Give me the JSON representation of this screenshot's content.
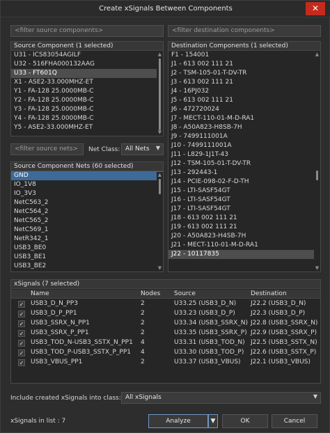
{
  "window": {
    "title": "Create xSignals Between Components",
    "close_glyph": "✕"
  },
  "source_filter": {
    "placeholder": "<filter source components>"
  },
  "destination_filter": {
    "placeholder": "<filter destination components>"
  },
  "source_components": {
    "header": "Source Component (1 selected)",
    "items": [
      "U31 - ICS83054AGILF",
      "U32 - 516FHA000132AAG",
      "U33 - FT601Q",
      "X1 - ASE2-33.000MHZ-ET",
      "Y1 - FA-128 25.0000MB-C",
      "Y2 - FA-128 25.0000MB-C",
      "Y3 - FA-128 25.0000MB-C",
      "Y4 - FA-128 25.0000MB-C",
      "Y5 - ASE2-33.000MHZ-ET"
    ],
    "selected_index": 2
  },
  "destination_components": {
    "header": "Destination Components (1 selected)",
    "items": [
      "F1 - 154001",
      "J1 - 613 002 111 21",
      "J2 - TSM-105-01-T-DV-TR",
      "J3 - 613 002 111 21",
      "J4 - 16PJ032",
      "J5 - 613 002 111 21",
      "J6 - 472720024",
      "J7 - MECT-110-01-M-D-RA1",
      "J8 - A50A823-H8SB-7H",
      "J9 - 7499111001A",
      "J10 - 7499111001A",
      "J11 - L829-1J1T-43",
      "J12 - TSM-105-01-T-DV-TR",
      "J13 - 292443-1",
      "J14 - PCIE-098-02-F-D-TH",
      "J15 - LTI-SASF54GT",
      "J16 - LTI-SASF54GT",
      "J17 - LTI-SASF54GT",
      "J18 - 613 002 111 21",
      "J19 - 613 002 111 21",
      "J20 - A50A823-H4SB-7H",
      "J21 - MECT-110-01-M-D-RA1",
      "J22 - 10117835"
    ],
    "selected_index": 22
  },
  "nets_filter": {
    "placeholder": "<filter source nets>"
  },
  "net_class": {
    "label": "Net Class:",
    "value": "All Nets"
  },
  "source_nets": {
    "header": "Source Component Nets (60 selected)",
    "items": [
      "GND",
      "IO_1V8",
      "IO_3V3",
      "NetC563_2",
      "NetC564_2",
      "NetC565_2",
      "NetC569_1",
      "NetR342_1",
      "USB3_BE0",
      "USB3_BE1",
      "USB3_BE2"
    ],
    "highlight_index": 0
  },
  "xsignals": {
    "header": "xSignals (7 selected)",
    "columns": {
      "name": "Name",
      "nodes": "Nodes",
      "source": "Source",
      "destination": "Destination"
    },
    "rows": [
      {
        "name": "USB3_D_N_PP3",
        "nodes": "2",
        "source": "U33.25 (USB3_D_N)",
        "destination": "J22.2 (USB3_D_N)"
      },
      {
        "name": "USB3_D_P_PP1",
        "nodes": "2",
        "source": "U33.23 (USB3_D_P)",
        "destination": "J22.3 (USB3_D_P)"
      },
      {
        "name": "USB3_SSRX_N_PP1",
        "nodes": "2",
        "source": "U33.34 (USB3_SSRX_N)",
        "destination": "J22.8 (USB3_SSRX_N)"
      },
      {
        "name": "USB3_SSRX_P_PP1",
        "nodes": "2",
        "source": "U33.35 (USB3_SSRX_P)",
        "destination": "J22.9 (USB3_SSRX_P)"
      },
      {
        "name": "USB3_TOD_N-USB3_SSTX_N_PP1",
        "nodes": "4",
        "source": "U33.31 (USB3_TOD_N)",
        "destination": "J22.5 (USB3_SSTX_N)"
      },
      {
        "name": "USB3_TOD_P-USB3_SSTX_P_PP1",
        "nodes": "4",
        "source": "U33.30 (USB3_TOD_P)",
        "destination": "J22.6 (USB3_SSTX_P)"
      },
      {
        "name": "USB3_VBUS_PP1",
        "nodes": "2",
        "source": "U33.37 (USB3_VBUS)",
        "destination": "J22.1 (USB3_VBUS)"
      }
    ],
    "check_glyph": "✓"
  },
  "include_class": {
    "label": "Include created xSignals into class:",
    "value": "All xSignals"
  },
  "footer": {
    "count_text": "xSignals in list : 7",
    "analyze_label": "Analyze",
    "ok_label": "OK",
    "cancel_label": "Cancel"
  }
}
